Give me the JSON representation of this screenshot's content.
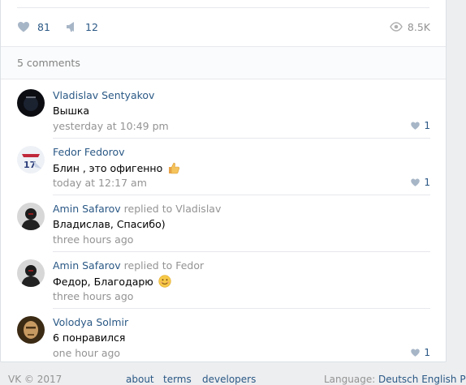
{
  "post_actions": {
    "likes": "81",
    "shares": "12",
    "views": "8.5K"
  },
  "comments_header": "5 comments",
  "comments": [
    {
      "author": "Vladislav Sentyakov",
      "reply_to": "",
      "text": "Вышка",
      "time": "yesterday at 10:49 pm",
      "likes": "1"
    },
    {
      "author": "Fedor Fedorov",
      "reply_to": "",
      "text": "Блин , это офигенно",
      "time": "today at 12:17 am",
      "likes": "1"
    },
    {
      "author": "Amin Safarov",
      "reply_to": "replied to Vladislav",
      "text": "Владислав, Спасибо)",
      "time": "three hours ago",
      "likes": ""
    },
    {
      "author": "Amin Safarov",
      "reply_to": "replied to Fedor",
      "text": "Федор, Благодарю",
      "time": "three hours ago",
      "likes": ""
    },
    {
      "author": "Volodya Solmir",
      "reply_to": "",
      "text": "6 понравился",
      "time": "one hour ago",
      "likes": "1"
    }
  ],
  "footer": {
    "copyright": "VK © 2017",
    "about": "about",
    "terms": "terms",
    "developers": "developers",
    "language_label": "Language:",
    "languages": "Deutsch English P"
  },
  "colors": {
    "link": "#2a5885",
    "muted": "#939393",
    "background": "#edeef0"
  }
}
